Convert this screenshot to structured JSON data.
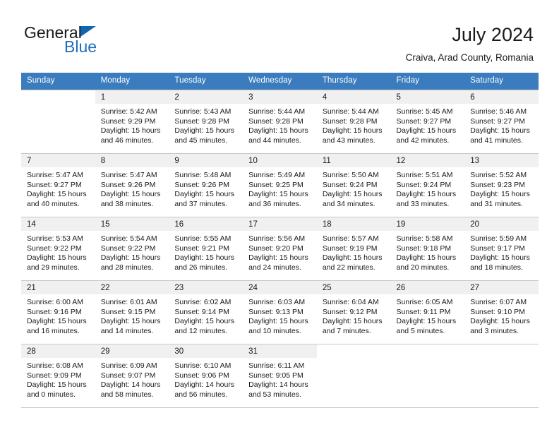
{
  "brand": {
    "word_one": "General",
    "word_two": "Blue",
    "logo_icon": "triangle-logo-icon"
  },
  "header": {
    "title": "July 2024",
    "subtitle": "Craiva, Arad County, Romania"
  },
  "colors": {
    "header_row_bg": "#3a7cbe",
    "daynum_bg": "#f0f0f0",
    "brand_blue": "#1f6dbb",
    "grid_line": "#c8c8c8"
  },
  "calendar": {
    "weekday_headers": [
      "Sunday",
      "Monday",
      "Tuesday",
      "Wednesday",
      "Thursday",
      "Friday",
      "Saturday"
    ],
    "weeks": [
      [
        {
          "day": "",
          "lines": []
        },
        {
          "day": "1",
          "lines": [
            "Sunrise: 5:42 AM",
            "Sunset: 9:29 PM",
            "Daylight: 15 hours",
            "and 46 minutes."
          ]
        },
        {
          "day": "2",
          "lines": [
            "Sunrise: 5:43 AM",
            "Sunset: 9:28 PM",
            "Daylight: 15 hours",
            "and 45 minutes."
          ]
        },
        {
          "day": "3",
          "lines": [
            "Sunrise: 5:44 AM",
            "Sunset: 9:28 PM",
            "Daylight: 15 hours",
            "and 44 minutes."
          ]
        },
        {
          "day": "4",
          "lines": [
            "Sunrise: 5:44 AM",
            "Sunset: 9:28 PM",
            "Daylight: 15 hours",
            "and 43 minutes."
          ]
        },
        {
          "day": "5",
          "lines": [
            "Sunrise: 5:45 AM",
            "Sunset: 9:27 PM",
            "Daylight: 15 hours",
            "and 42 minutes."
          ]
        },
        {
          "day": "6",
          "lines": [
            "Sunrise: 5:46 AM",
            "Sunset: 9:27 PM",
            "Daylight: 15 hours",
            "and 41 minutes."
          ]
        }
      ],
      [
        {
          "day": "7",
          "lines": [
            "Sunrise: 5:47 AM",
            "Sunset: 9:27 PM",
            "Daylight: 15 hours",
            "and 40 minutes."
          ]
        },
        {
          "day": "8",
          "lines": [
            "Sunrise: 5:47 AM",
            "Sunset: 9:26 PM",
            "Daylight: 15 hours",
            "and 38 minutes."
          ]
        },
        {
          "day": "9",
          "lines": [
            "Sunrise: 5:48 AM",
            "Sunset: 9:26 PM",
            "Daylight: 15 hours",
            "and 37 minutes."
          ]
        },
        {
          "day": "10",
          "lines": [
            "Sunrise: 5:49 AM",
            "Sunset: 9:25 PM",
            "Daylight: 15 hours",
            "and 36 minutes."
          ]
        },
        {
          "day": "11",
          "lines": [
            "Sunrise: 5:50 AM",
            "Sunset: 9:24 PM",
            "Daylight: 15 hours",
            "and 34 minutes."
          ]
        },
        {
          "day": "12",
          "lines": [
            "Sunrise: 5:51 AM",
            "Sunset: 9:24 PM",
            "Daylight: 15 hours",
            "and 33 minutes."
          ]
        },
        {
          "day": "13",
          "lines": [
            "Sunrise: 5:52 AM",
            "Sunset: 9:23 PM",
            "Daylight: 15 hours",
            "and 31 minutes."
          ]
        }
      ],
      [
        {
          "day": "14",
          "lines": [
            "Sunrise: 5:53 AM",
            "Sunset: 9:22 PM",
            "Daylight: 15 hours",
            "and 29 minutes."
          ]
        },
        {
          "day": "15",
          "lines": [
            "Sunrise: 5:54 AM",
            "Sunset: 9:22 PM",
            "Daylight: 15 hours",
            "and 28 minutes."
          ]
        },
        {
          "day": "16",
          "lines": [
            "Sunrise: 5:55 AM",
            "Sunset: 9:21 PM",
            "Daylight: 15 hours",
            "and 26 minutes."
          ]
        },
        {
          "day": "17",
          "lines": [
            "Sunrise: 5:56 AM",
            "Sunset: 9:20 PM",
            "Daylight: 15 hours",
            "and 24 minutes."
          ]
        },
        {
          "day": "18",
          "lines": [
            "Sunrise: 5:57 AM",
            "Sunset: 9:19 PM",
            "Daylight: 15 hours",
            "and 22 minutes."
          ]
        },
        {
          "day": "19",
          "lines": [
            "Sunrise: 5:58 AM",
            "Sunset: 9:18 PM",
            "Daylight: 15 hours",
            "and 20 minutes."
          ]
        },
        {
          "day": "20",
          "lines": [
            "Sunrise: 5:59 AM",
            "Sunset: 9:17 PM",
            "Daylight: 15 hours",
            "and 18 minutes."
          ]
        }
      ],
      [
        {
          "day": "21",
          "lines": [
            "Sunrise: 6:00 AM",
            "Sunset: 9:16 PM",
            "Daylight: 15 hours",
            "and 16 minutes."
          ]
        },
        {
          "day": "22",
          "lines": [
            "Sunrise: 6:01 AM",
            "Sunset: 9:15 PM",
            "Daylight: 15 hours",
            "and 14 minutes."
          ]
        },
        {
          "day": "23",
          "lines": [
            "Sunrise: 6:02 AM",
            "Sunset: 9:14 PM",
            "Daylight: 15 hours",
            "and 12 minutes."
          ]
        },
        {
          "day": "24",
          "lines": [
            "Sunrise: 6:03 AM",
            "Sunset: 9:13 PM",
            "Daylight: 15 hours",
            "and 10 minutes."
          ]
        },
        {
          "day": "25",
          "lines": [
            "Sunrise: 6:04 AM",
            "Sunset: 9:12 PM",
            "Daylight: 15 hours",
            "and 7 minutes."
          ]
        },
        {
          "day": "26",
          "lines": [
            "Sunrise: 6:05 AM",
            "Sunset: 9:11 PM",
            "Daylight: 15 hours",
            "and 5 minutes."
          ]
        },
        {
          "day": "27",
          "lines": [
            "Sunrise: 6:07 AM",
            "Sunset: 9:10 PM",
            "Daylight: 15 hours",
            "and 3 minutes."
          ]
        }
      ],
      [
        {
          "day": "28",
          "lines": [
            "Sunrise: 6:08 AM",
            "Sunset: 9:09 PM",
            "Daylight: 15 hours",
            "and 0 minutes."
          ]
        },
        {
          "day": "29",
          "lines": [
            "Sunrise: 6:09 AM",
            "Sunset: 9:07 PM",
            "Daylight: 14 hours",
            "and 58 minutes."
          ]
        },
        {
          "day": "30",
          "lines": [
            "Sunrise: 6:10 AM",
            "Sunset: 9:06 PM",
            "Daylight: 14 hours",
            "and 56 minutes."
          ]
        },
        {
          "day": "31",
          "lines": [
            "Sunrise: 6:11 AM",
            "Sunset: 9:05 PM",
            "Daylight: 14 hours",
            "and 53 minutes."
          ]
        },
        {
          "day": "",
          "lines": []
        },
        {
          "day": "",
          "lines": []
        },
        {
          "day": "",
          "lines": []
        }
      ]
    ]
  }
}
